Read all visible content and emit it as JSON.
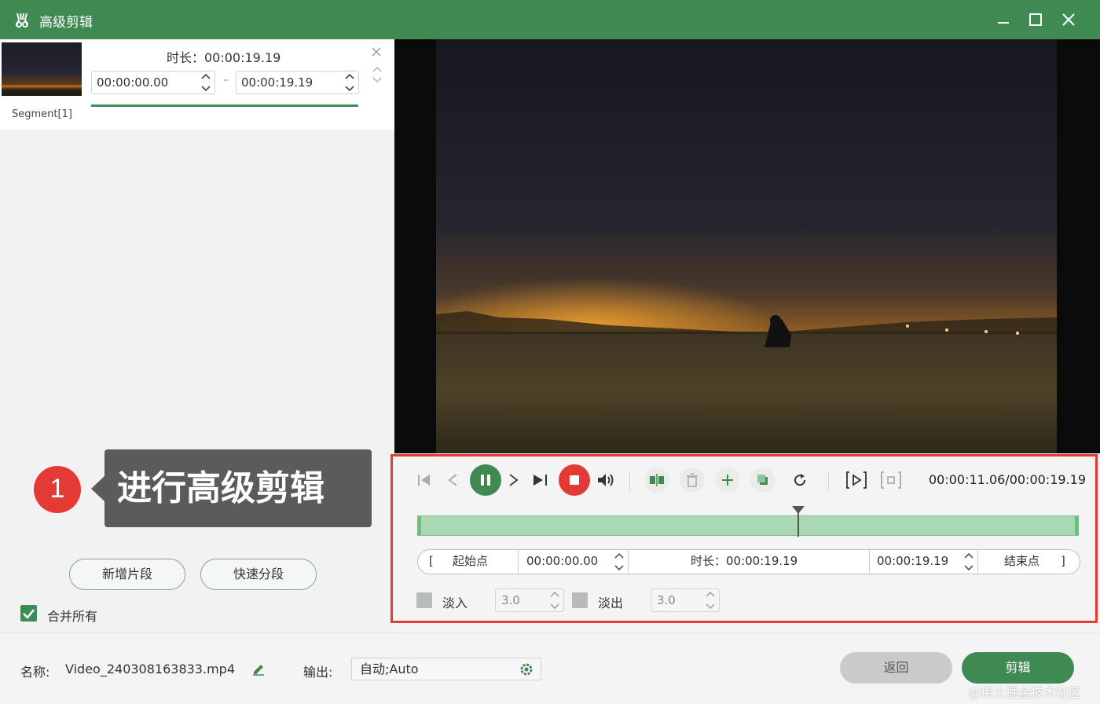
{
  "window": {
    "title": "高级剪辑",
    "accent": "#3f8a53"
  },
  "segment": {
    "label": "Segment[1]",
    "duration_text": "时长：00:00:19.19",
    "start": "00:00:00.00",
    "separator": "–",
    "end": "00:00:19.19"
  },
  "annotation": {
    "step": "1",
    "text": "进行高级剪辑"
  },
  "left_actions": {
    "add_segment": "新增片段",
    "quick_split": "快速分段",
    "merge_all": "合并所有",
    "merge_checked": true
  },
  "player": {
    "time_readout": "00:00:11.06/00:00:19.19",
    "playhead_fraction": 0.576
  },
  "trim": {
    "start_label": "起始点",
    "start_time": "00:00:00.00",
    "duration": "时长：00:00:19.19",
    "end_time": "00:00:19.19",
    "end_label": "结束点",
    "open_bracket": "[",
    "close_bracket": "]"
  },
  "fade": {
    "in_label": "淡入",
    "in_value": "3.0",
    "out_label": "淡出",
    "out_value": "3.0"
  },
  "bottom": {
    "name_label": "名称:",
    "filename": "Video_240308163833.mp4",
    "output_label": "输出:",
    "output_value": "自动;Auto",
    "back": "返回",
    "cut": "剪辑"
  },
  "watermark": "@稀土掘金技术社区",
  "colors": {
    "stop_red": "#e53935",
    "track_green": "#a9d8b3",
    "highlight_border": "#e53935"
  }
}
